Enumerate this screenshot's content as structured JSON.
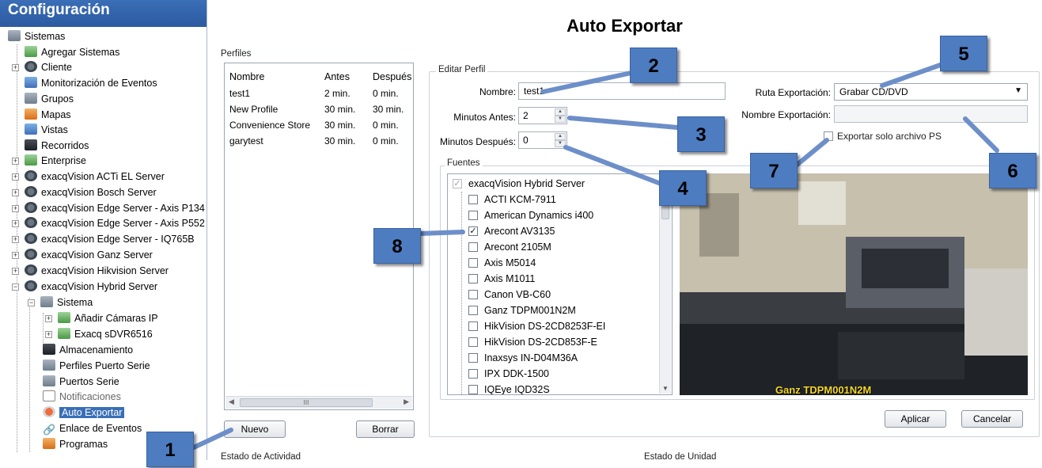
{
  "sidebar": {
    "title": "Configuración",
    "items": [
      {
        "label": "Sistemas"
      },
      {
        "label": "Agregar Sistemas"
      },
      {
        "label": "Cliente"
      },
      {
        "label": "Monitorización de Eventos"
      },
      {
        "label": "Grupos"
      },
      {
        "label": "Mapas"
      },
      {
        "label": "Vistas"
      },
      {
        "label": "Recorridos"
      },
      {
        "label": "Enterprise"
      },
      {
        "label": "exacqVision ACTi EL Server"
      },
      {
        "label": "exacqVision Bosch Server"
      },
      {
        "label": "exacqVision Edge Server - Axis P134"
      },
      {
        "label": "exacqVision Edge Server - Axis P552"
      },
      {
        "label": "exacqVision Edge Server - IQ765B"
      },
      {
        "label": "exacqVision Ganz Server"
      },
      {
        "label": "exacqVision Hikvision Server"
      },
      {
        "label": "exacqVision Hybrid Server"
      },
      {
        "label": "Sistema"
      },
      {
        "label": "Añadir Cámaras IP"
      },
      {
        "label": "Exacq sDVR6516"
      },
      {
        "label": "Almacenamiento"
      },
      {
        "label": "Perfiles Puerto Serie"
      },
      {
        "label": "Puertos Serie"
      },
      {
        "label": "Notificaciones"
      },
      {
        "label": "Auto Exportar"
      },
      {
        "label": "Enlace de Eventos"
      },
      {
        "label": "Programas"
      }
    ]
  },
  "main": {
    "title": "Auto Exportar",
    "perfiles": {
      "label": "Perfiles",
      "columns": [
        "Nombre",
        "Antes",
        "Después"
      ],
      "rows": [
        [
          "test1",
          "2 min.",
          "0 min."
        ],
        [
          "New Profile",
          "30 min.",
          "30 min."
        ],
        [
          "Convenience Store",
          "30 min.",
          "0 min."
        ],
        [
          "garytest",
          "30 min.",
          "0 min."
        ]
      ],
      "scroll_grip": "III",
      "nuevo_label": "Nuevo",
      "borrar_label": "Borrar"
    },
    "editar": {
      "label": "Editar Perfil",
      "nombre_label": "Nombre:",
      "nombre_value": "test1",
      "minutos_antes_label": "Minutos Antes:",
      "minutos_antes_value": "2",
      "minutos_despues_label": "Minutos Después:",
      "minutos_despues_value": "0",
      "ruta_label": "Ruta Exportación:",
      "ruta_value": "Grabar CD/DVD",
      "nombre_export_label": "Nombre Exportación:",
      "nombre_export_value": "",
      "solo_ps_label": "Exportar solo archivo PS",
      "solo_ps_checked": false,
      "fuentes_label": "Fuentes",
      "fuentes": {
        "server": "exacqVision Hybrid Server",
        "cameras": [
          {
            "name": "ACTI KCM-7911",
            "checked": false
          },
          {
            "name": "American Dynamics i400",
            "checked": false
          },
          {
            "name": "Arecont AV3135",
            "checked": true
          },
          {
            "name": "Arecont 2105M",
            "checked": false
          },
          {
            "name": "Axis M5014",
            "checked": false
          },
          {
            "name": "Axis M1011",
            "checked": false
          },
          {
            "name": "Canon VB-C60",
            "checked": false
          },
          {
            "name": "Ganz TDPM001N2M",
            "checked": false
          },
          {
            "name": "HikVision DS-2CD8253F-EI",
            "checked": false
          },
          {
            "name": "HikVision DS-2CD853F-E",
            "checked": false
          },
          {
            "name": "Inaxsys IN-D04M36A",
            "checked": false
          },
          {
            "name": "IPX DDK-1500",
            "checked": false
          },
          {
            "name": "IQEye IQD32S",
            "checked": false
          }
        ]
      },
      "camera_overlay_label": "Ganz TDPM001N2M",
      "aplicar_label": "Aplicar",
      "cancelar_label": "Cancelar"
    },
    "estado_actividad_label": "Estado de Actividad",
    "estado_unidad_label": "Estado de Unidad"
  },
  "annotations": [
    "1",
    "2",
    "3",
    "4",
    "5",
    "6",
    "7",
    "8"
  ],
  "colors": {
    "header_blue": "#2c5aa0",
    "badge_blue": "#4d7cc0",
    "selection_blue": "#3a6fb6",
    "camera_label_yellow": "#f4d72c"
  }
}
